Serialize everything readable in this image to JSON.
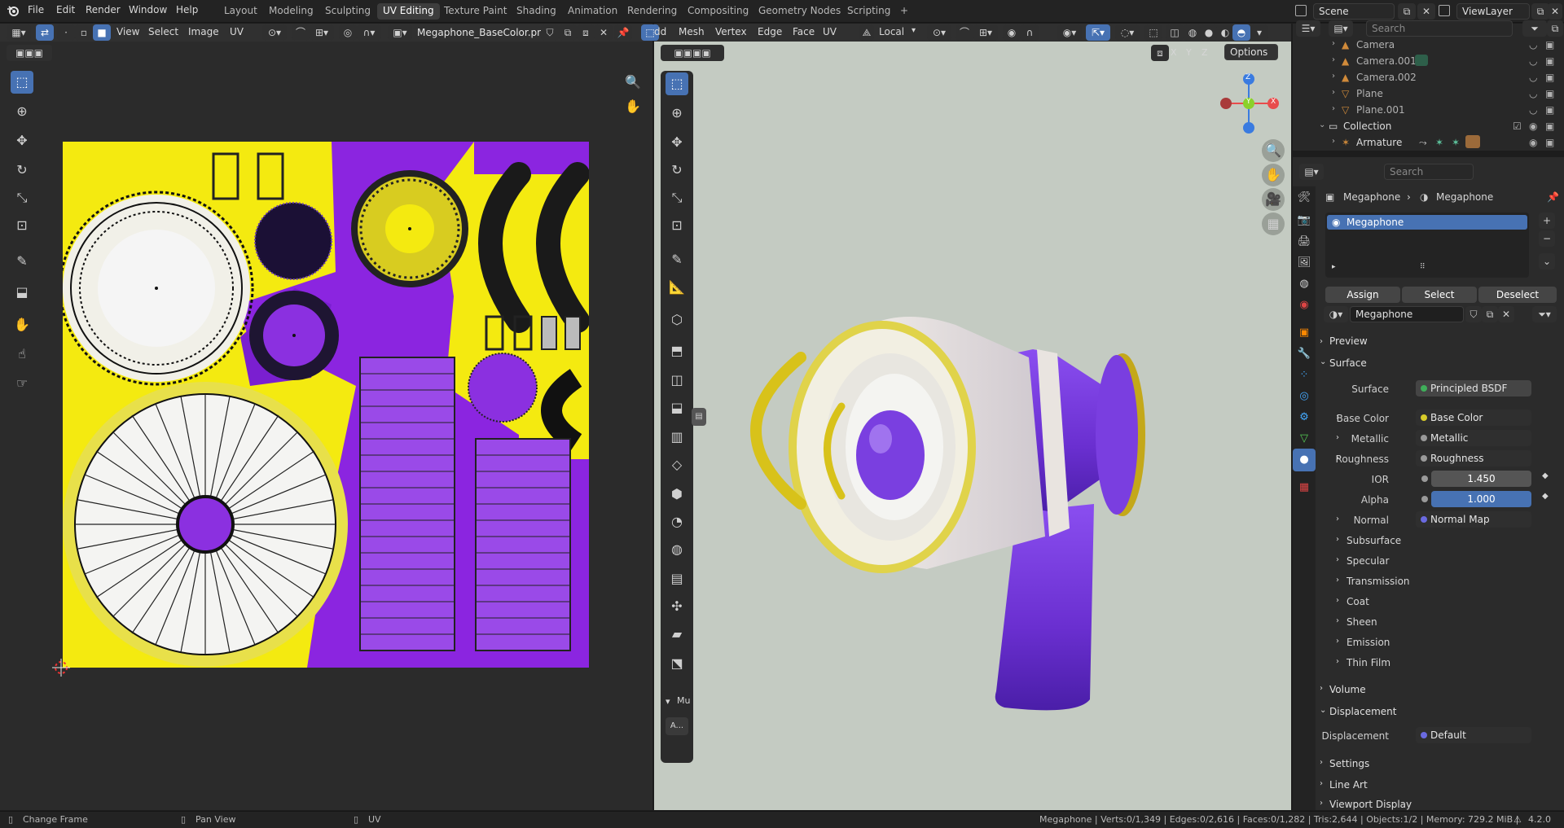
{
  "topbar": {
    "menus": [
      "File",
      "Edit",
      "Render",
      "Window",
      "Help"
    ],
    "workspaces": [
      "Layout",
      "Modeling",
      "Sculpting",
      "UV Editing",
      "Texture Paint",
      "Shading",
      "Animation",
      "Rendering",
      "Compositing",
      "Geometry Nodes",
      "Scripting"
    ],
    "active_workspace": "UV Editing",
    "add_workspace": "+",
    "scene": "Scene",
    "view_layer": "ViewLayer"
  },
  "uv_editor": {
    "menus": [
      "View",
      "Select",
      "Image",
      "UV"
    ],
    "image_name": "Megaphone_BaseColor.png"
  },
  "viewport": {
    "menus": [
      "dd",
      "Mesh",
      "Vertex",
      "Edge",
      "Face",
      "UV"
    ],
    "orientation": "Local",
    "axis_labels": [
      "X",
      "Y",
      "Z"
    ],
    "options_label": "Options",
    "gizmo": {
      "x": "X",
      "y": "Y",
      "z": "Z"
    },
    "last_op_label": "Mu",
    "last_op_btn": "A..."
  },
  "outliner": {
    "search_placeholder": "Search",
    "rows": [
      {
        "name": "Camera",
        "level": 1
      },
      {
        "name": "Camera.001",
        "level": 1
      },
      {
        "name": "Camera.002",
        "level": 1
      },
      {
        "name": "Plane",
        "level": 1
      },
      {
        "name": "Plane.001",
        "level": 1
      },
      {
        "name": "Collection",
        "level": 0
      },
      {
        "name": "Armature",
        "level": 1
      }
    ]
  },
  "properties": {
    "search_placeholder": "Search",
    "breadcrumb_object": "Megaphone",
    "breadcrumb_material": "Megaphone",
    "slot_name": "Megaphone",
    "assign": "Assign",
    "select": "Select",
    "deselect": "Deselect",
    "material_name": "Megaphone",
    "panels": {
      "preview": "Preview",
      "surface": "Surface",
      "surface_label": "Surface",
      "surface_value": "Principled BSDF",
      "base_color_label": "Base Color",
      "base_color_value": "Base Color",
      "metallic_label": "Metallic",
      "metallic_value": "Metallic",
      "roughness_label": "Roughness",
      "roughness_value": "Roughness",
      "ior_label": "IOR",
      "ior_value": "1.450",
      "alpha_label": "Alpha",
      "alpha_value": "1.000",
      "normal_label": "Normal",
      "normal_value": "Normal Map",
      "subsurface": "Subsurface",
      "specular": "Specular",
      "transmission": "Transmission",
      "coat": "Coat",
      "sheen": "Sheen",
      "emission": "Emission",
      "thin_film": "Thin Film",
      "volume": "Volume",
      "displacement": "Displacement",
      "displacement_label": "Displacement",
      "displacement_value": "Default",
      "settings": "Settings",
      "line_art": "Line Art",
      "viewport_display": "Viewport Display"
    }
  },
  "statusbar": {
    "change_frame": "Change Frame",
    "pan_view": "Pan View",
    "uv": "UV",
    "stats": "Megaphone | Verts:0/1,349 | Edges:0/2,616 | Faces:0/1,282 | Tris:2,644 | Objects:1/2 | Memory: 729.2 MiB |",
    "version": "4.2.0"
  },
  "colors": {
    "accent": "#4772b3",
    "purple": "#7a2fd6",
    "yellow": "#f2e400"
  }
}
